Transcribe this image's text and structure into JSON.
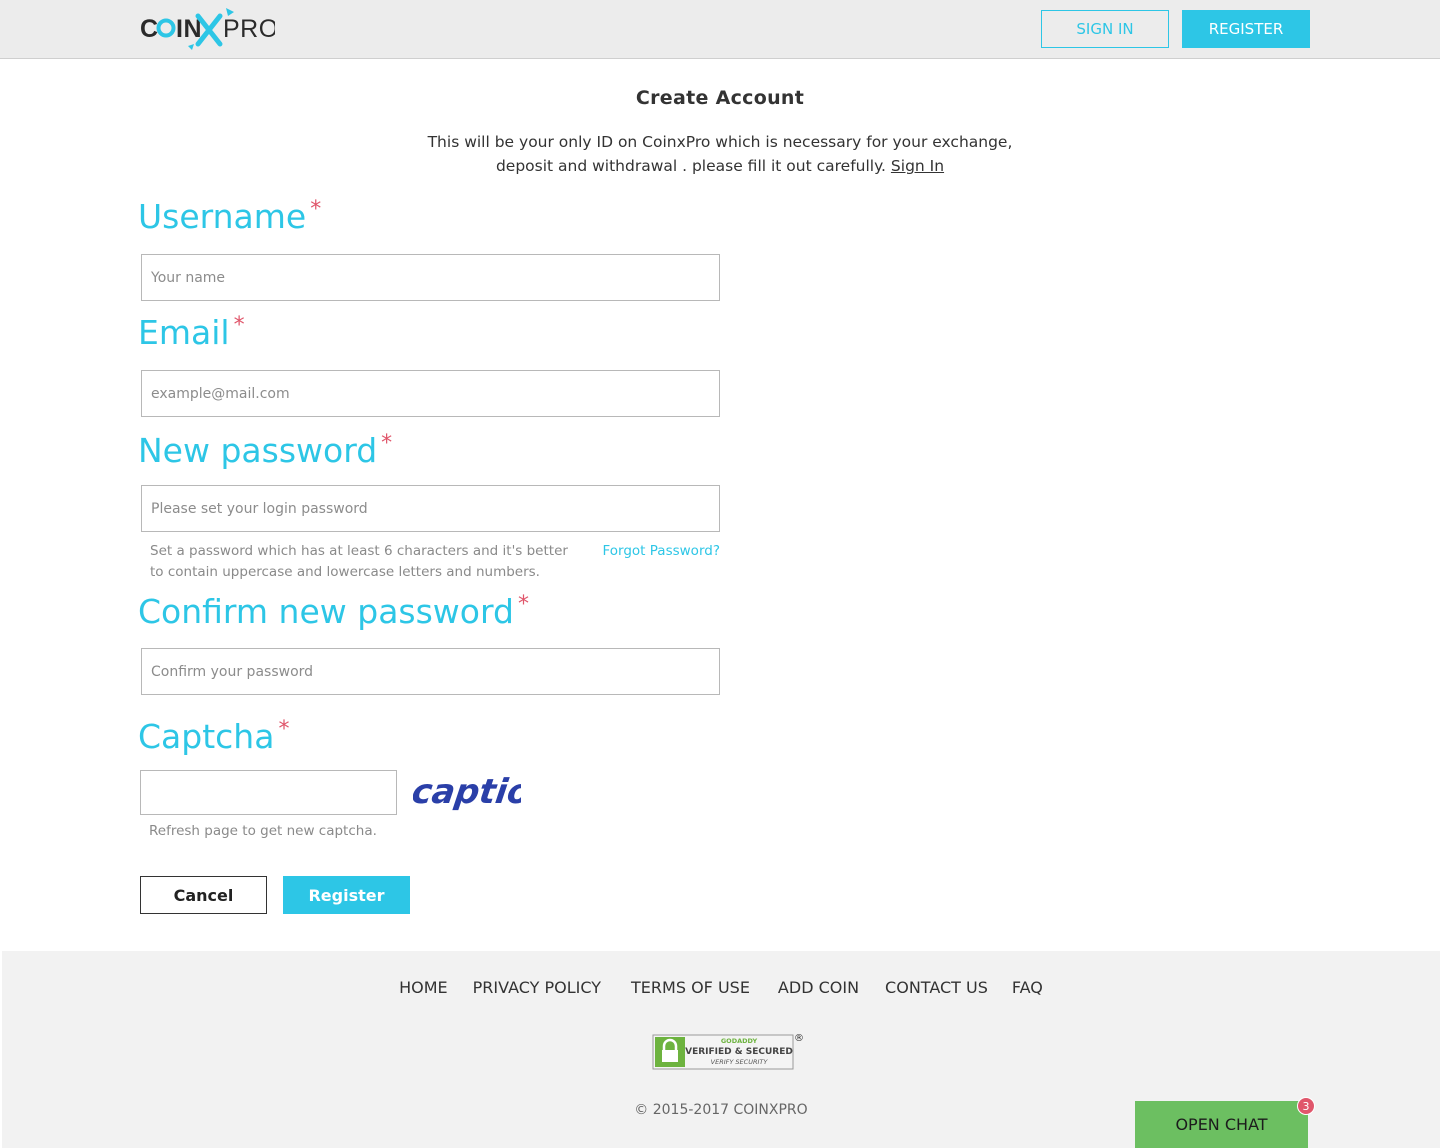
{
  "header": {
    "logo_text": "COINXPRO",
    "sign_in_label": "SIGN IN",
    "register_label": "REGISTER"
  },
  "page": {
    "title": "Create Account",
    "intro_text": "This will be your only ID on CoinxPro which is necessary for your exchange, deposit and withdrawal . please fill it out carefully.",
    "intro_link": "Sign In"
  },
  "form": {
    "required_marker": "*",
    "username": {
      "label": "Username",
      "placeholder": "Your name",
      "value": ""
    },
    "email": {
      "label": "Email",
      "placeholder": "example@mail.com",
      "value": ""
    },
    "new_password": {
      "label": "New password",
      "placeholder": "Please set your login password",
      "value": "",
      "hint": "Set a password which has at least 6 characters and it's better to contain uppercase and lowercase letters and numbers.",
      "forgot_label": "Forgot Password?"
    },
    "confirm_password": {
      "label": "Confirm new password",
      "placeholder": "Confirm your password",
      "value": ""
    },
    "captcha": {
      "label": "Captcha",
      "value": "",
      "image_text": "captio",
      "hint": "Refresh page to get new captcha."
    },
    "cancel_label": "Cancel",
    "register_label": "Register"
  },
  "footer": {
    "nav": [
      "HOME",
      "PRIVACY POLICY",
      "TERMS OF USE",
      "ADD COIN",
      "CONTACT US",
      "FAQ"
    ],
    "badge": {
      "line1": "GODADDY",
      "line2": "VERIFIED & SECURED",
      "line3": "VERIFY SECURITY",
      "mark": "®"
    },
    "copyright": "© 2015-2017 COINXPRO"
  },
  "chat": {
    "label": "OPEN CHAT",
    "unread_count": "3"
  },
  "colors": {
    "accent": "#2dc6e6",
    "required": "#e0566b",
    "chat": "#6cbf61",
    "topbar": "#ececec",
    "footer": "#f2f2f2"
  }
}
